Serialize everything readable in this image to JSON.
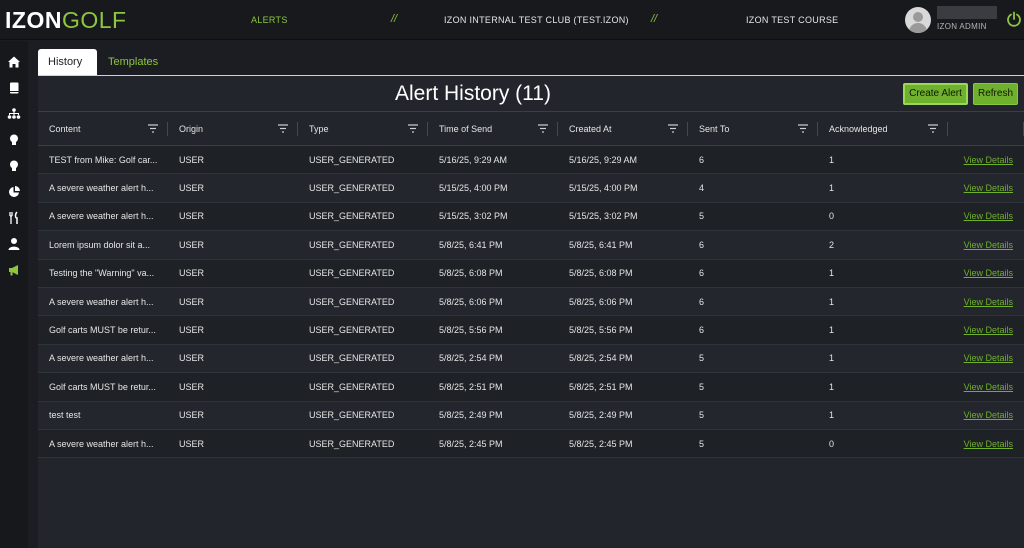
{
  "header": {
    "logo_izon": "IZON",
    "logo_golf": "GOLF",
    "nav_alerts": "ALERTS",
    "separator": "//",
    "club": "IZON INTERNAL TEST CLUB (TEST.IZON)",
    "course": "IZON TEST COURSE",
    "user_role": "IZON ADMIN"
  },
  "sidebar": {
    "items": [
      {
        "icon": "home-icon"
      },
      {
        "icon": "book-icon"
      },
      {
        "icon": "org-chart-icon"
      },
      {
        "icon": "lightbulb-icon"
      },
      {
        "icon": "lightbulb-icon"
      },
      {
        "icon": "pie-chart-icon"
      },
      {
        "icon": "utensils-icon"
      },
      {
        "icon": "user-icon"
      },
      {
        "icon": "megaphone-icon",
        "active": true
      }
    ]
  },
  "tabs": [
    {
      "label": "History",
      "active": true
    },
    {
      "label": "Templates",
      "active": false
    }
  ],
  "main": {
    "title": "Alert History (11)",
    "create_label": "Create Alert",
    "refresh_label": "Refresh"
  },
  "table": {
    "columns": [
      "Content",
      "Origin",
      "Type",
      "Time of Send",
      "Created At",
      "Sent To",
      "Acknowledged",
      ""
    ],
    "link_label": "View Details",
    "rows": [
      [
        "TEST from Mike: Golf car...",
        "USER",
        "USER_GENERATED",
        "5/16/25, 9:29 AM",
        "5/16/25, 9:29 AM",
        "6",
        "1"
      ],
      [
        "A severe weather alert h...",
        "USER",
        "USER_GENERATED",
        "5/15/25, 4:00 PM",
        "5/15/25, 4:00 PM",
        "4",
        "1"
      ],
      [
        "A severe weather alert h...",
        "USER",
        "USER_GENERATED",
        "5/15/25, 3:02 PM",
        "5/15/25, 3:02 PM",
        "5",
        "0"
      ],
      [
        "Lorem ipsum dolor sit a...",
        "USER",
        "USER_GENERATED",
        "5/8/25, 6:41 PM",
        "5/8/25, 6:41 PM",
        "6",
        "2"
      ],
      [
        "Testing the \"Warning\" va...",
        "USER",
        "USER_GENERATED",
        "5/8/25, 6:08 PM",
        "5/8/25, 6:08 PM",
        "6",
        "1"
      ],
      [
        "A severe weather alert h...",
        "USER",
        "USER_GENERATED",
        "5/8/25, 6:06 PM",
        "5/8/25, 6:06 PM",
        "6",
        "1"
      ],
      [
        "Golf carts MUST be retur...",
        "USER",
        "USER_GENERATED",
        "5/8/25, 5:56 PM",
        "5/8/25, 5:56 PM",
        "6",
        "1"
      ],
      [
        "A severe weather alert h...",
        "USER",
        "USER_GENERATED",
        "5/8/25, 2:54 PM",
        "5/8/25, 2:54 PM",
        "5",
        "1"
      ],
      [
        "Golf carts MUST be retur...",
        "USER",
        "USER_GENERATED",
        "5/8/25, 2:51 PM",
        "5/8/25, 2:51 PM",
        "5",
        "1"
      ],
      [
        "test test",
        "USER",
        "USER_GENERATED",
        "5/8/25, 2:49 PM",
        "5/8/25, 2:49 PM",
        "5",
        "1"
      ],
      [
        "A severe weather alert h...",
        "USER",
        "USER_GENERATED",
        "5/8/25, 2:45 PM",
        "5/8/25, 2:45 PM",
        "5",
        "0"
      ]
    ]
  },
  "colors": {
    "accent": "#8dc63f",
    "button": "#6fb02c",
    "background": "#1b1d22"
  }
}
